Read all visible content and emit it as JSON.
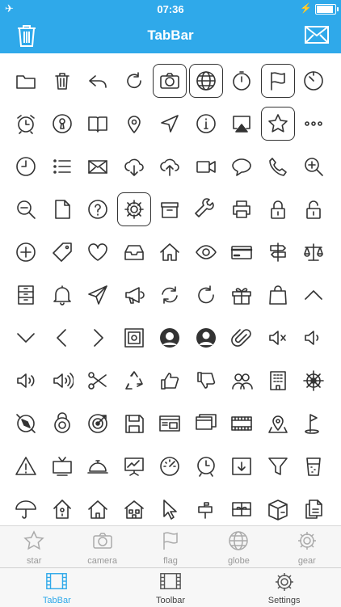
{
  "status": {
    "time": "07:36"
  },
  "nav": {
    "title": "TabBar"
  },
  "grid": {
    "icons": [
      "folder-icon",
      "trash-icon",
      "reply-icon",
      "refresh-icon",
      "camera-icon",
      "globe-icon",
      "stopwatch-icon",
      "flag-icon",
      "timer-icon",
      "alarm-clock-icon",
      "keyhole-icon",
      "book-icon",
      "map-pin-icon",
      "navigation-icon",
      "info-icon",
      "airplay-icon",
      "star-icon",
      "more-icon",
      "clock-icon",
      "list-icon",
      "mail-icon",
      "cloud-download-icon",
      "cloud-upload-icon",
      "video-icon",
      "chat-bubble-icon",
      "phone-icon",
      "zoom-in-icon",
      "zoom-out-icon",
      "document-icon",
      "help-icon",
      "gear-icon",
      "archive-box-icon",
      "wrench-icon",
      "printer-icon",
      "lock-icon",
      "unlock-icon",
      "add-circle-icon",
      "tag-icon",
      "heart-icon",
      "inbox-icon",
      "home-icon",
      "eye-icon",
      "credit-card-icon",
      "signpost-icon",
      "scales-icon",
      "drawers-icon",
      "bell-icon",
      "send-icon",
      "megaphone-icon",
      "sync-icon",
      "reload-icon",
      "gift-icon",
      "shopping-bag-icon",
      "chevron-up-icon",
      "chevron-down-icon",
      "chevron-left-icon",
      "chevron-right-icon",
      "safe-icon",
      "female-user-icon",
      "male-user-icon",
      "paperclip-icon",
      "volume-mute-icon",
      "volume-low-icon",
      "volume-medium-icon",
      "volume-high-icon",
      "scissors-icon",
      "recycle-icon",
      "thumbs-up-icon",
      "thumbs-down-icon",
      "users-icon",
      "building-icon",
      "ship-wheel-icon",
      "compass-icon",
      "combination-lock-icon",
      "target-icon",
      "floppy-disk-icon",
      "browser-window-icon",
      "windows-icon",
      "film-strip-icon",
      "location-pin-icon",
      "golf-flag-icon",
      "warning-icon",
      "tv-icon",
      "service-bell-icon",
      "presentation-icon",
      "speedometer-icon",
      "wall-clock-icon",
      "download-box-icon",
      "funnel-icon",
      "drink-glass-icon",
      "umbrella-icon",
      "birdhouse-icon",
      "house-icon",
      "large-house-icon",
      "cursor-icon",
      "mailbox-icon",
      "gift-card-icon",
      "package-icon",
      "copy-document-icon"
    ],
    "selected": [
      "camera-icon",
      "globe-icon",
      "flag-icon",
      "star-icon",
      "gear-icon"
    ]
  },
  "strip": {
    "items": [
      {
        "label": "star",
        "icon": "star-icon"
      },
      {
        "label": "camera",
        "icon": "camera-icon"
      },
      {
        "label": "flag",
        "icon": "flag-icon"
      },
      {
        "label": "globe",
        "icon": "globe-icon"
      },
      {
        "label": "gear",
        "icon": "gear-icon"
      }
    ]
  },
  "tabbar": {
    "tabs": [
      {
        "label": "TabBar",
        "icon": "film-icon",
        "active": true
      },
      {
        "label": "Toolbar",
        "icon": "film-icon",
        "active": false
      },
      {
        "label": "Settings",
        "icon": "gear-icon",
        "active": false
      }
    ]
  },
  "colors": {
    "accent": "#2fa9ea",
    "icon": "#333333",
    "inactive": "#999999"
  }
}
